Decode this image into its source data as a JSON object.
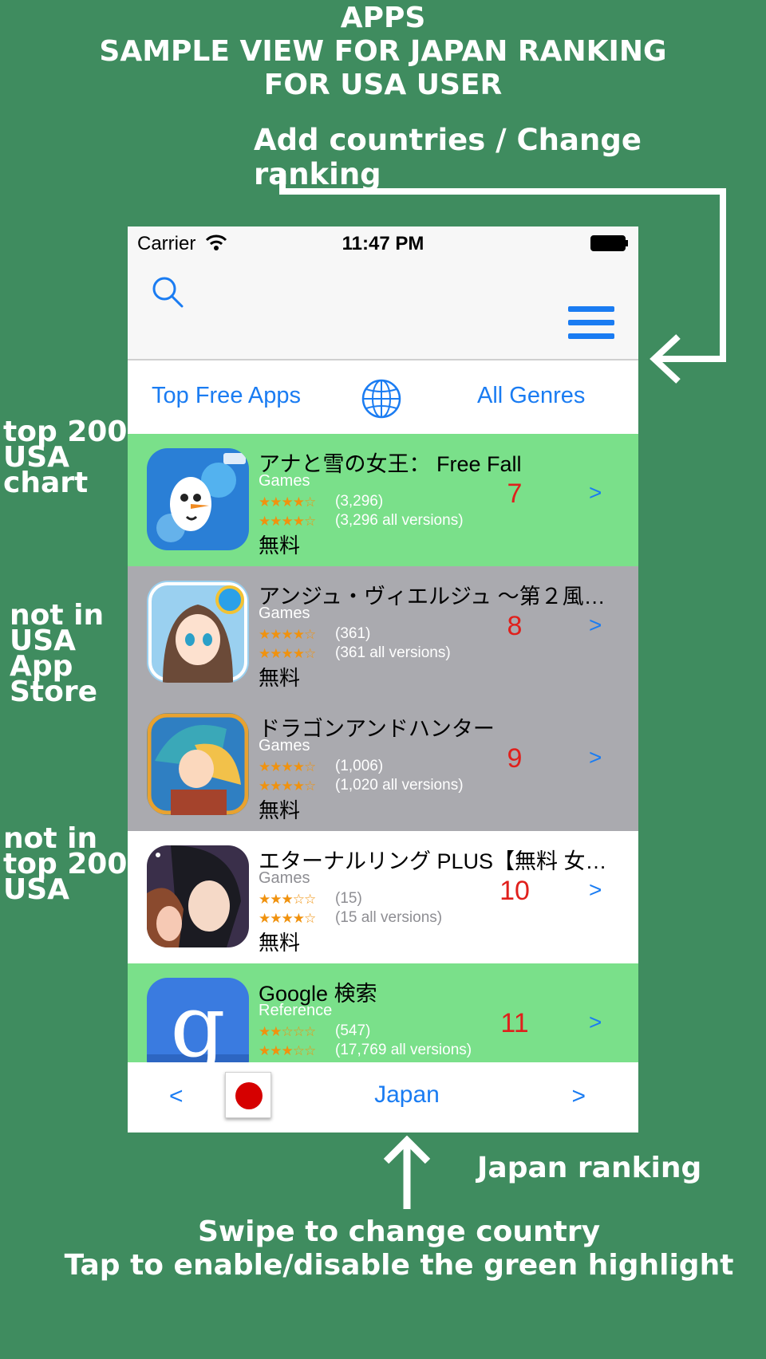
{
  "annotations": {
    "header_title": "APPS\nSAMPLE VIEW FOR JAPAN RANKING\nFOR USA USER",
    "add_countries": "Add countries / Change ranking",
    "top200_note": "top 200\nUSA\nchart",
    "not_in_usa_note": "not in\nUSA\nApp\nStore",
    "not_in_top200_note": "not in\ntop 200\nUSA",
    "japan_ranking": "Japan ranking",
    "swipe_note": "Swipe to change country\nTap to enable/disable the green highlight"
  },
  "status_bar": {
    "carrier": "Carrier",
    "time": "11:47 PM"
  },
  "segment": {
    "left_label": "Top Free Apps",
    "right_label": "All Genres"
  },
  "apps": [
    {
      "title": "アナと雪の女王： Free Fall",
      "genre": "Games",
      "stars_current": "★★★★☆",
      "stars_all": "★★★★☆",
      "rating_current": "(3,296)",
      "rating_all": "(3,296 all versions)",
      "price": "無料",
      "rank": "7",
      "chevron": ">",
      "highlight": "green"
    },
    {
      "title": "アンジュ・ヴィエルジュ ～第２風紀委...",
      "genre": "Games",
      "stars_current": "★★★★☆",
      "stars_all": "★★★★☆",
      "rating_current": "(361)",
      "rating_all": "(361 all versions)",
      "price": "無料",
      "rank": "8",
      "chevron": ">",
      "highlight": "gray"
    },
    {
      "title": "ドラゴンアンドハンター",
      "genre": "Games",
      "stars_current": "★★★★☆",
      "stars_all": "★★★★☆",
      "rating_current": "(1,006)",
      "rating_all": "(1,020 all versions)",
      "price": "無料",
      "rank": "9",
      "chevron": ">",
      "highlight": "gray"
    },
    {
      "title": "エターナルリング PLUS【無料 女性向...",
      "genre": "Games",
      "stars_current": "★★★☆☆",
      "stars_all": "★★★★☆",
      "rating_current": "(15)",
      "rating_all": "(15 all versions)",
      "price": "無料",
      "rank": "10",
      "chevron": ">",
      "highlight": "white"
    },
    {
      "title": "Google 検索",
      "genre": "Reference",
      "stars_current": "★★☆☆☆",
      "stars_all": "★★★☆☆",
      "rating_current": "(547)",
      "rating_all": "(17,769 all versions)",
      "price": "無料",
      "rank": "11",
      "chevron": ">",
      "highlight": "green"
    }
  ],
  "bottom_bar": {
    "prev": "<",
    "country": "Japan",
    "next": ">"
  },
  "colors": {
    "background": "#3f8c5f",
    "accent": "#1a7cf2",
    "rank": "#e0201c",
    "green_highlight": "#7ae08a",
    "gray_highlight": "#aaaaaf"
  },
  "icons": {
    "search": "search-icon",
    "menu": "hamburger-menu-icon",
    "globe": "globe-icon",
    "flag": "japan-flag-icon"
  }
}
